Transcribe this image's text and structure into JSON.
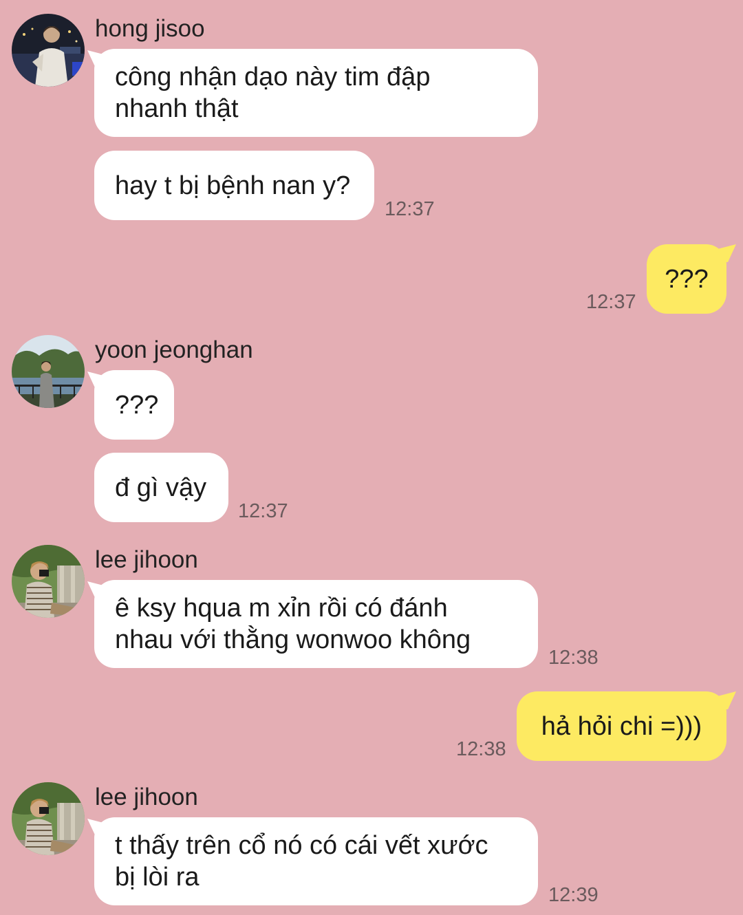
{
  "messages": [
    {
      "sender": "hong jisoo",
      "avatar": "hong-jisoo-avatar",
      "lines": [
        "công nhận dạo này tim đập",
        "nhanh thật"
      ]
    },
    {
      "text": "hay t bị bệnh nan y?",
      "time": "12:37"
    },
    {
      "own": true,
      "text": "???",
      "time": "12:37"
    },
    {
      "sender": "yoon jeonghan",
      "avatar": "yoon-jeonghan-avatar",
      "text": "???"
    },
    {
      "text": "đ gì vậy",
      "time": "12:37"
    },
    {
      "sender": "lee jihoon",
      "avatar": "lee-jihoon-avatar",
      "lines": [
        "ê ksy hqua m xỉn rồi có đánh",
        "nhau với thằng wonwoo không"
      ],
      "time": "12:38"
    },
    {
      "own": true,
      "text": "hả hỏi chi =)))",
      "time": "12:38"
    },
    {
      "sender": "lee jihoon",
      "avatar": "lee-jihoon-avatar",
      "lines": [
        "t thấy trên cổ nó có cái vết xước",
        "bị lòi ra"
      ],
      "time": "12:39"
    }
  ],
  "colors": {
    "background": "#e4aeb4",
    "incoming_bubble": "#ffffff",
    "outgoing_bubble": "#fdea62",
    "timestamp": "#6a5a5c"
  }
}
